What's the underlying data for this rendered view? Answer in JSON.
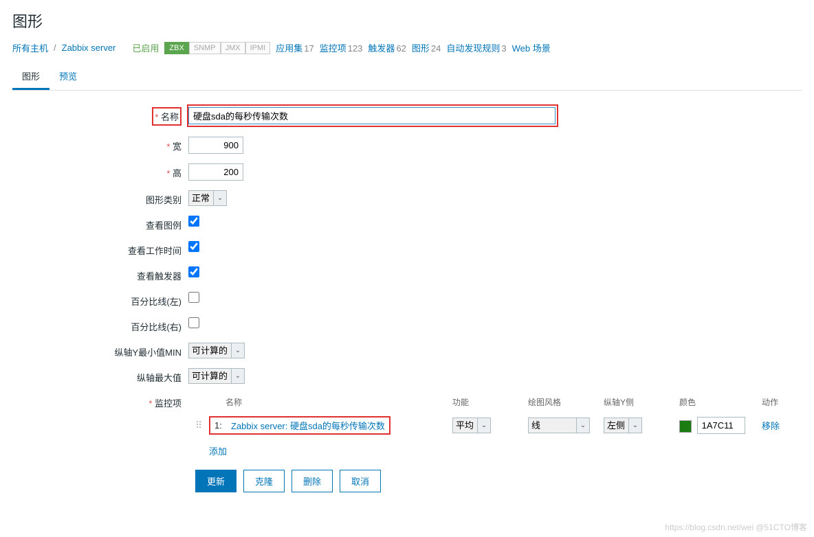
{
  "page_title": "图形",
  "breadcrumb": {
    "all_hosts": "所有主机",
    "server": "Zabbix server",
    "enabled": "已启用",
    "badges": {
      "zbx": "ZBX",
      "snmp": "SNMP",
      "jmx": "JMX",
      "ipmi": "IPMI"
    },
    "apps": {
      "label": "应用集",
      "count": "17"
    },
    "items": {
      "label": "监控项",
      "count": "123"
    },
    "triggers": {
      "label": "触发器",
      "count": "62"
    },
    "graphs": {
      "label": "图形",
      "count": "24"
    },
    "discovery": {
      "label": "自动发现规则",
      "count": "3"
    },
    "web": {
      "label": "Web 场景"
    }
  },
  "tabs": {
    "graph": "图形",
    "preview": "预览"
  },
  "form": {
    "name_label": "名称",
    "name_value": "硬盘sda的每秒传输次数",
    "width_label": "宽",
    "width_value": "900",
    "height_label": "高",
    "height_value": "200",
    "type_label": "图形类别",
    "type_value": "正常",
    "legend_label": "查看图例",
    "worktime_label": "查看工作时间",
    "triggers_label": "查看触发器",
    "pct_left_label": "百分比线(左)",
    "pct_right_label": "百分比线(右)",
    "ymin_label": "纵轴Y最小值MIN",
    "ymin_value": "可计算的",
    "ymax_label": "纵轴最大值",
    "ymax_value": "可计算的",
    "items_label": "监控项"
  },
  "items_header": {
    "name": "名称",
    "func": "功能",
    "style": "绘图风格",
    "yside": "纵轴Y侧",
    "color": "颜色",
    "action": "动作"
  },
  "items": [
    {
      "num": "1:",
      "name": "Zabbix server: 硬盘sda的每秒传输次数",
      "func": "平均",
      "style": "线",
      "yside": "左侧",
      "color": "1A7C11",
      "remove": "移除"
    }
  ],
  "add_link": "添加",
  "buttons": {
    "update": "更新",
    "clone": "克隆",
    "delete": "删除",
    "cancel": "取消"
  },
  "watermark": "https://blog.csdn.net/wei @51CTO博客"
}
